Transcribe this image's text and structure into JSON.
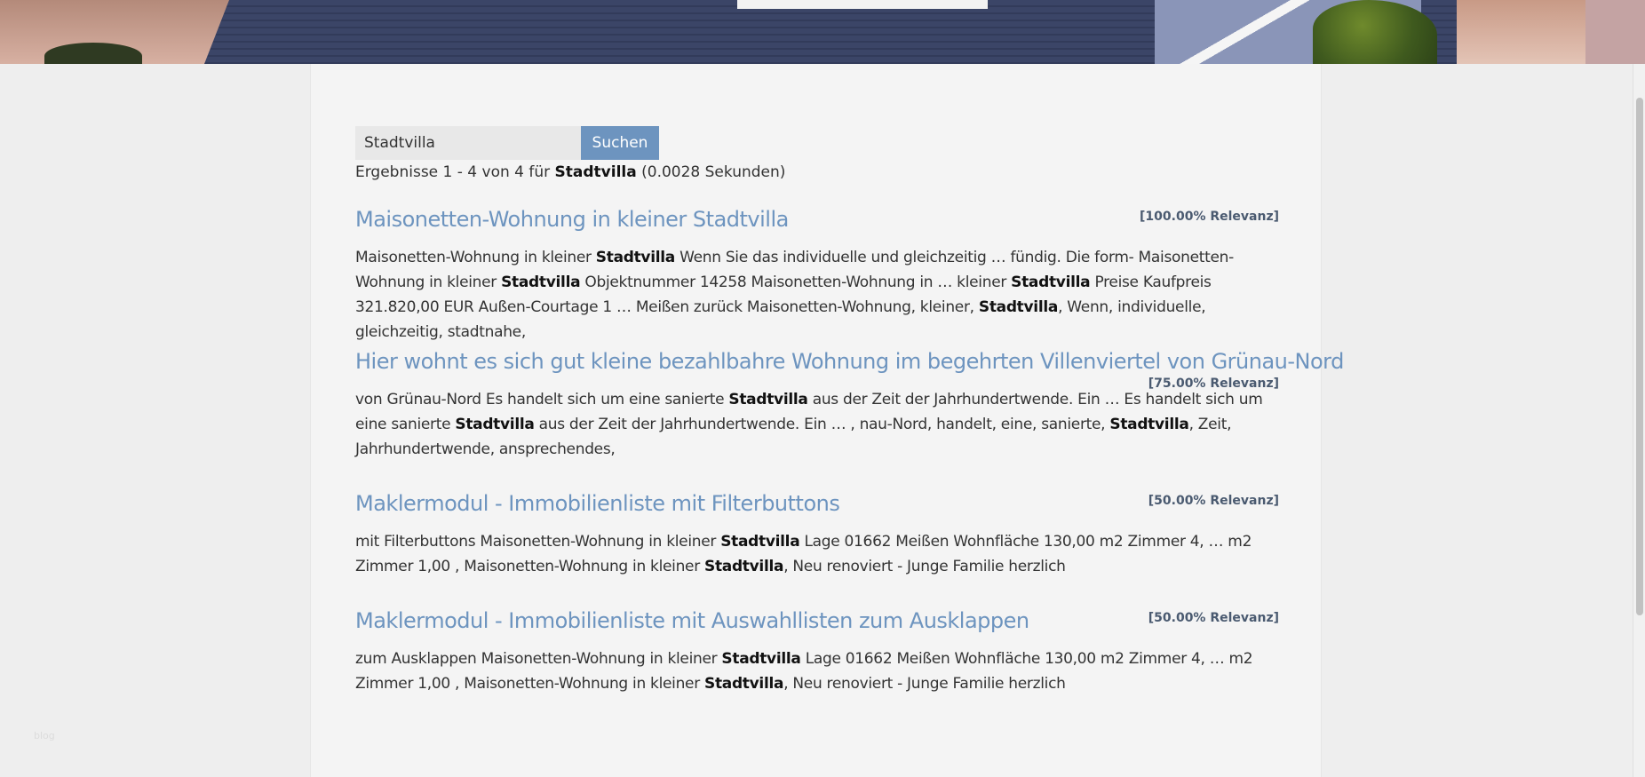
{
  "search": {
    "value": "Stadtvilla",
    "button_label": "Suchen"
  },
  "summary": {
    "prefix": "Ergebnisse 1 - 4 von 4 für ",
    "term": "Stadtvilla",
    "suffix": " (0.0028 Sekunden)"
  },
  "results": [
    {
      "title": "Maisonetten-Wohnung in kleiner Stadtvilla",
      "relevance": "[100.00% Relevanz]",
      "snippet": [
        {
          "t": "Maisonetten-Wohnung in kleiner ",
          "b": false
        },
        {
          "t": "Stadtvilla",
          "b": true
        },
        {
          "t": " Wenn Sie das individuelle und gleichzeitig … fündig. Die form- Maisonetten-Wohnung in kleiner ",
          "b": false
        },
        {
          "t": "Stadtvilla",
          "b": true
        },
        {
          "t": " Objektnummer 14258 Maisonetten-Wohnung in … kleiner ",
          "b": false
        },
        {
          "t": "Stadtvilla",
          "b": true
        },
        {
          "t": " Preise Kaufpreis 321.820,00 EUR Außen-Courtage 1 … Meißen zurück Maisonetten-Wohnung, kleiner, ",
          "b": false
        },
        {
          "t": "Stadtvilla",
          "b": true
        },
        {
          "t": ", Wenn, individuelle, gleichzeitig, stadtnahe,",
          "b": false
        }
      ]
    },
    {
      "title": "Hier wohnt es sich gut kleine bezahlbahre Wohnung im begehrten Villenviertel von Grünau-Nord",
      "relevance": "[75.00% Relevanz]",
      "snippet": [
        {
          "t": "von Grünau-Nord Es handelt sich um eine sanierte ",
          "b": false
        },
        {
          "t": "Stadtvilla",
          "b": true
        },
        {
          "t": " aus der Zeit der Jahrhundertwende. Ein … Es handelt sich um eine sanierte ",
          "b": false
        },
        {
          "t": "Stadtvilla",
          "b": true
        },
        {
          "t": " aus der Zeit der Jahrhundertwende. Ein … , nau-Nord, handelt, eine, sanierte, ",
          "b": false
        },
        {
          "t": "Stadtvilla",
          "b": true
        },
        {
          "t": ", Zeit, Jahrhundertwende, ansprechendes,",
          "b": false
        }
      ]
    },
    {
      "title": "Maklermodul - Immobilienliste mit Filterbuttons",
      "relevance": "[50.00% Relevanz]",
      "snippet": [
        {
          "t": "mit Filterbuttons Maisonetten-Wohnung in kleiner ",
          "b": false
        },
        {
          "t": "Stadtvilla",
          "b": true
        },
        {
          "t": " Lage 01662 Meißen Wohnfläche 130,00 m2 Zimmer 4, … m2 Zimmer 1,00 , Maisonetten-Wohnung in kleiner ",
          "b": false
        },
        {
          "t": "Stadtvilla",
          "b": true
        },
        {
          "t": ", Neu renoviert - Junge Familie herzlich",
          "b": false
        }
      ]
    },
    {
      "title": "Maklermodul - Immobilienliste mit Auswahllisten zum Ausklappen",
      "relevance": "[50.00% Relevanz]",
      "snippet": [
        {
          "t": "zum Ausklappen Maisonetten-Wohnung in kleiner ",
          "b": false
        },
        {
          "t": "Stadtvilla",
          "b": true
        },
        {
          "t": " Lage 01662 Meißen Wohnfläche 130,00 m2 Zimmer 4, … m2 Zimmer 1,00 , Maisonetten-Wohnung in kleiner ",
          "b": false
        },
        {
          "t": "Stadtvilla",
          "b": true
        },
        {
          "t": ", Neu renoviert - Junge Familie herzlich",
          "b": false
        }
      ]
    }
  ],
  "footer": {
    "blog_label": "blog"
  }
}
